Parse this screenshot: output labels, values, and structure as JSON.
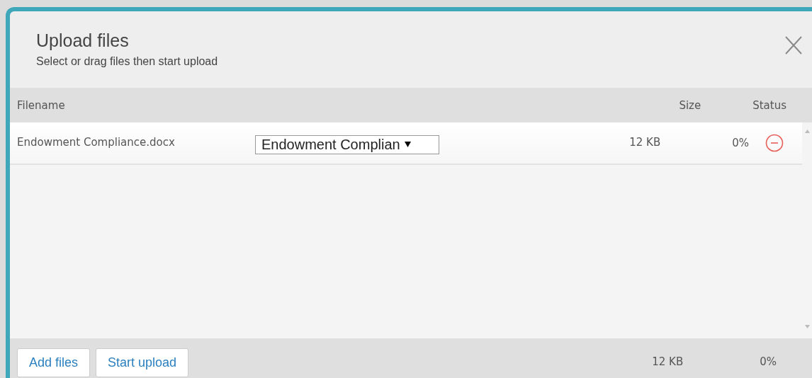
{
  "dialog": {
    "title": "Upload files",
    "subtitle": "Select or drag files then start upload"
  },
  "table": {
    "columns": [
      "Filename",
      "Size",
      "Status"
    ],
    "rows": [
      {
        "filename": "Endowment Compliance.docx",
        "category": "Endowment Complian",
        "size": "12 KB",
        "progress": "0%"
      }
    ]
  },
  "footer": {
    "buttons": [
      "Add files",
      "Start upload"
    ],
    "total_size": "12 KB",
    "total_progress": "0%"
  }
}
